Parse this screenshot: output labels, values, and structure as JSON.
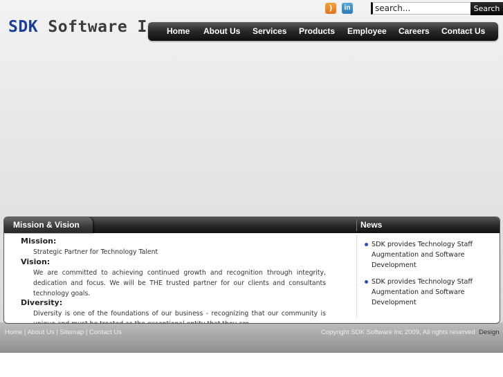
{
  "logo": {
    "part1": "SDK",
    "part2": "Software Inc"
  },
  "social": {
    "rss_icon": "rss-icon",
    "linkedin_icon": "linkedin-icon",
    "linkedin_label": "in"
  },
  "search": {
    "value": "search...",
    "button": "Search"
  },
  "nav": {
    "items": [
      "Home",
      "About Us",
      "Services",
      "Products",
      "Employee",
      "Careers",
      "Contact Us"
    ]
  },
  "mission": {
    "title": "Mission & Vision",
    "mission_label": "Mission:",
    "mission_text": "Strategic Partner for Technology Talent",
    "vision_label": "Vision:",
    "vision_text": "We are committed to achieving continued growth and recognition through integrity, dedication and focus. We will be THE trusted partner for our clients and consultants technology goals.",
    "diversity_label": "Diversity:",
    "diversity_text": "Diversity is one of the foundations of our business - recognizing that our community is unique and must be treated as the exceptional entity that they are"
  },
  "news": {
    "title": "News",
    "items": [
      "SDK provides Technology Staff Augmentation and Software Development",
      "SDK provides Technology Staff Augmentation and Software Development"
    ]
  },
  "footer": {
    "links": [
      "Home",
      "About Us",
      "Sitemap",
      "Contact Us"
    ],
    "separator": "|",
    "copyright": "Copyright SDK Software Inc 2009, All rights reserved",
    "design": "Design"
  },
  "colors": {
    "brand_blue": "#1a3f9a",
    "nav_dark": "#1a1a1a",
    "bullet_blue": "#2b4fbf"
  }
}
